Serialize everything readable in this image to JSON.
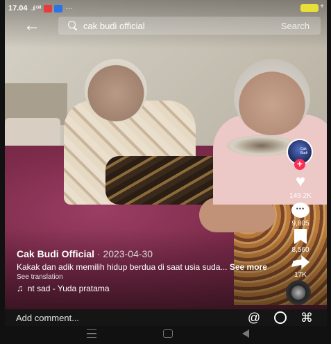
{
  "status_bar": {
    "time": "17.04",
    "signal": "..ıl ᵒ⁸ᴵ",
    "more": "···"
  },
  "search": {
    "query": "cak budi official",
    "button": "Search"
  },
  "creator": {
    "avatar_text": "Cak Budi",
    "follow": "+"
  },
  "actions": {
    "likes": "149.2K",
    "comments": "9,805",
    "saves": "8,560",
    "shares": "17K"
  },
  "post": {
    "author": "Cak Budi Official",
    "date": " · 2023-04-30",
    "description": "Kakak dan adik memilih hidup berdua di saat usia suda...",
    "see_more": "See more",
    "translation": "See translation",
    "music_icon": "♫",
    "music": "nt sad - Yuda pratama"
  },
  "comment_bar": {
    "placeholder": "Add comment...",
    "mention_icon": "@",
    "emoji_icon": "☺",
    "gift_icon": "🎁"
  },
  "colors": {
    "accent": "#fe2c55",
    "battery": "#e8e038"
  }
}
